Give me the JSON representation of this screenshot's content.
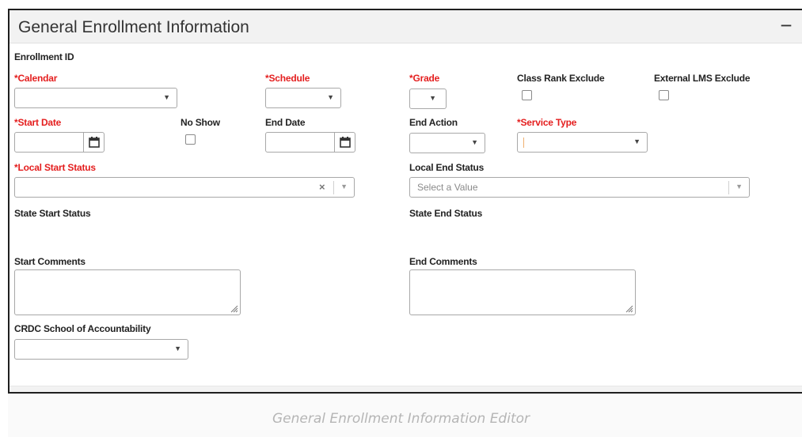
{
  "panel": {
    "title": "General Enrollment Information",
    "collapse_label": "−"
  },
  "labels": {
    "enrollment_id": "Enrollment ID",
    "calendar": "*Calendar",
    "schedule": "*Schedule",
    "grade": "*Grade",
    "class_rank_exclude": "Class Rank Exclude",
    "external_lms_exclude": "External LMS Exclude",
    "start_date": "*Start Date",
    "no_show": "No Show",
    "end_date": "End Date",
    "end_action": "End Action",
    "service_type": "*Service Type",
    "local_start_status": "*Local Start Status",
    "local_end_status": "Local End Status",
    "state_start_status": "State Start Status",
    "state_end_status": "State End Status",
    "start_comments": "Start Comments",
    "end_comments": "End Comments",
    "crdc_school": "CRDC School of Accountability"
  },
  "fields": {
    "local_end_status_placeholder": "Select a Value",
    "calendar_value": "",
    "schedule_value": "",
    "grade_value": "",
    "end_action_value": "",
    "service_type_value": "",
    "local_start_status_value": "",
    "crdc_school_value": "",
    "start_date_value": "",
    "end_date_value": "",
    "start_comments_value": "",
    "end_comments_value": ""
  },
  "checkboxes": {
    "class_rank_exclude": false,
    "external_lms_exclude": false,
    "no_show": false
  },
  "icons": {
    "dropdown": "chevron-down-icon",
    "calendar": "calendar-icon",
    "clear": "clear-x-icon",
    "resize": "resize-grip-icon"
  },
  "colors": {
    "required_label": "#e41e1e",
    "header_bg": "#f2f2f2",
    "border": "#a8a8a8"
  },
  "caption": "General Enrollment Information Editor"
}
